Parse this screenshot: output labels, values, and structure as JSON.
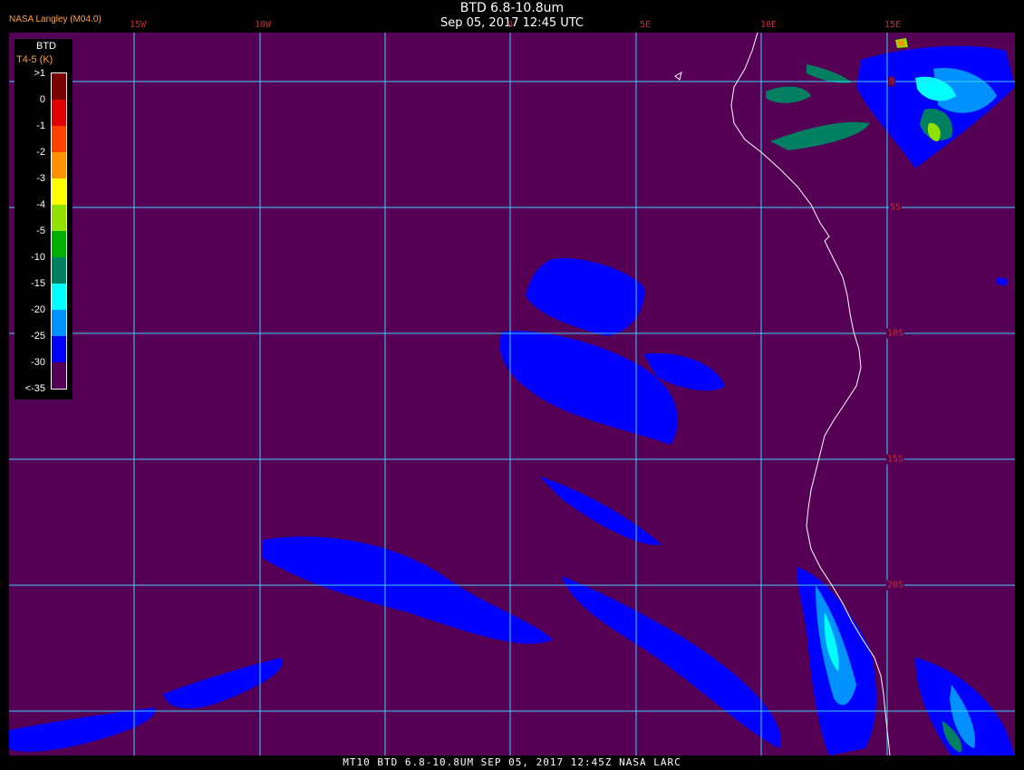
{
  "header": {
    "title": "BTD 6.8-10.8um",
    "datetime": "Sep 05, 2017 12:45 UTC",
    "org": "NASA Langley (M04.0)"
  },
  "footer": {
    "text": "MT10  BTD 6.8-10.8UM   SEP 05, 2017 12:45Z   NASA LARC"
  },
  "map": {
    "background_color": "#550055",
    "grid_color": "#40d0ff",
    "coast_color": "#ffffff",
    "label_color": "#c03030",
    "lon_labels": [
      "15W",
      "10W",
      "0",
      "5E",
      "10E",
      "15E"
    ],
    "lat_labels": [
      "0",
      "5S",
      "10S",
      "15S",
      "20S"
    ]
  },
  "legend": {
    "title": "BTD",
    "unit": "T4-5 (K)",
    "labels": [
      ">1",
      "0",
      "-1",
      "-2",
      "-3",
      "-4",
      "-5",
      "-10",
      "-15",
      "-20",
      "-25",
      "-30",
      "<-35"
    ],
    "colors": [
      "#7a0000",
      "#e00000",
      "#ff4000",
      "#ff9000",
      "#ffff00",
      "#90e000",
      "#00b000",
      "#008060",
      "#00ffff",
      "#0090ff",
      "#0000ff",
      "#550055"
    ]
  }
}
